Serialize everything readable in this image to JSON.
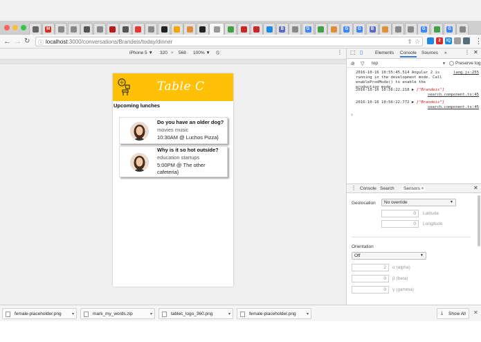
{
  "browser": {
    "url_host": "localhost",
    "url_path": ":3000/conversations/Brandeis/today/dinner",
    "tabs": [
      {
        "icon": "mail-icon",
        "color": "#666666",
        "glyph": ""
      },
      {
        "icon": "gmail-icon",
        "color": "#d93025",
        "glyph": "M"
      },
      {
        "icon": "doc-icon",
        "color": "#888888",
        "glyph": ""
      },
      {
        "icon": "doc-icon",
        "color": "#888888",
        "glyph": ""
      },
      {
        "icon": "bookmark-icon",
        "color": "#555555",
        "glyph": ""
      },
      {
        "icon": "doc-icon",
        "color": "#888888",
        "glyph": ""
      },
      {
        "icon": "image-icon",
        "color": "#b71c1c",
        "glyph": ""
      },
      {
        "icon": "printer-icon",
        "color": "#555555",
        "glyph": ""
      },
      {
        "icon": "flipboard-icon",
        "color": "#e53935",
        "glyph": ""
      },
      {
        "icon": "doc-icon",
        "color": "#888888",
        "glyph": ""
      },
      {
        "icon": "github-icon",
        "color": "#222222",
        "glyph": ""
      },
      {
        "icon": "dollar-icon",
        "color": "#f0a500",
        "glyph": ""
      },
      {
        "icon": "pinwheel-icon",
        "color": "#e0903a",
        "glyph": ""
      },
      {
        "icon": "github-icon",
        "color": "#222222",
        "glyph": ""
      },
      {
        "icon": "active-tab-icon",
        "color": "#999999",
        "glyph": "",
        "active": true
      },
      {
        "icon": "green-ext-icon",
        "color": "#43a047",
        "glyph": ""
      },
      {
        "icon": "red-book-icon",
        "color": "#c62828",
        "glyph": ""
      },
      {
        "icon": "red-ext-icon",
        "color": "#c62828",
        "glyph": ""
      },
      {
        "icon": "grid-icon",
        "color": "#1e88e5",
        "glyph": ""
      },
      {
        "icon": "b-icon",
        "color": "#5c6bc0",
        "glyph": "B"
      },
      {
        "icon": "doc-icon",
        "color": "#888888",
        "glyph": ""
      },
      {
        "icon": "google-icon",
        "color": "#4285f4",
        "glyph": "G"
      },
      {
        "icon": "green-ext-icon",
        "color": "#43a047",
        "glyph": ""
      },
      {
        "icon": "pinwheel-icon",
        "color": "#e0903a",
        "glyph": ""
      },
      {
        "icon": "google-icon",
        "color": "#4285f4",
        "glyph": "G"
      },
      {
        "icon": "google-icon",
        "color": "#4285f4",
        "glyph": "G"
      },
      {
        "icon": "b-icon",
        "color": "#5c6bc0",
        "glyph": "B"
      },
      {
        "icon": "pinwheel-icon",
        "color": "#e0903a",
        "glyph": ""
      },
      {
        "icon": "doc-icon",
        "color": "#888888",
        "glyph": ""
      },
      {
        "icon": "doc-icon",
        "color": "#888888",
        "glyph": ""
      },
      {
        "icon": "google-icon",
        "color": "#4285f4",
        "glyph": "G"
      },
      {
        "icon": "green-ext-icon",
        "color": "#43a047",
        "glyph": ""
      },
      {
        "icon": "google-icon",
        "color": "#4285f4",
        "glyph": "G"
      },
      {
        "icon": "doc-icon",
        "color": "#888888",
        "glyph": ""
      }
    ],
    "extensions": [
      {
        "icon": "globe-icon",
        "color": "#1e88e5",
        "glyph": ""
      },
      {
        "icon": "badge-icon",
        "color": "#d32f2f",
        "glyph": "2"
      },
      {
        "icon": "iq-icon",
        "color": "#1e88e5",
        "glyph": "IQ"
      },
      {
        "icon": "square-icon",
        "color": "#9e9e9e",
        "glyph": ""
      },
      {
        "icon": "ghost-icon",
        "color": "#546e7a",
        "glyph": ""
      }
    ]
  },
  "device_toolbar": {
    "device": "iPhone 5 ▼",
    "width": "320",
    "times": "×",
    "height": "568",
    "zoom": "100% ▼"
  },
  "app": {
    "title": "Table C",
    "section_title": "Upcoming lunches",
    "header_color": "#ffc107",
    "lunches": [
      {
        "title": "Do you have an older dog?",
        "tags": "movies music",
        "when": "10:30AM @ Luchos Pizza}"
      },
      {
        "title": "Why is it so hot outside?",
        "tags": "education startups",
        "when": "5:00PM @ The other cafeteria}"
      }
    ]
  },
  "devtools": {
    "tabs": [
      "Elements",
      "Console",
      "Sources",
      "»"
    ],
    "active_tab": "Console",
    "context": "top",
    "preserve_log": "Preserve log",
    "logs": [
      {
        "text": "2016-10-16 10:55:45.514 Angular 2 is running in the development mode. Call enableProdMode() to enable the production mode.",
        "source": "lang.js:255"
      },
      {
        "text": "2016-10-16 10:56:22.218 ▶",
        "value": "[\"Brandeis\"]",
        "source": "search.component.ts:45"
      },
      {
        "text": "2016-10-16 10:56:22.772 ▶",
        "value": "[\"Brandeis\"]",
        "source": "search.component.ts:45"
      }
    ],
    "prompt": "›",
    "drawer": {
      "tabs": [
        "Console",
        "Search",
        "Sensors ×"
      ],
      "geolocation_label": "Geolocation",
      "geolocation_value": "No override",
      "latitude": "0",
      "latitude_label": "Latitude",
      "longitude": "0",
      "longitude_label": "Longitude",
      "orientation_label": "Orientation",
      "orientation_value": "Off",
      "alpha": "2",
      "alpha_label": "α (alpha)",
      "beta": "0",
      "beta_label": "β (beta)",
      "gamma": "0",
      "gamma_label": "γ (gamma)"
    }
  },
  "downloads": {
    "files": [
      "female-placeholder.png",
      "mark_my_words.zip",
      "tablec_logo_360.png",
      "female-placeholder.png"
    ],
    "show_all": "Show All"
  }
}
